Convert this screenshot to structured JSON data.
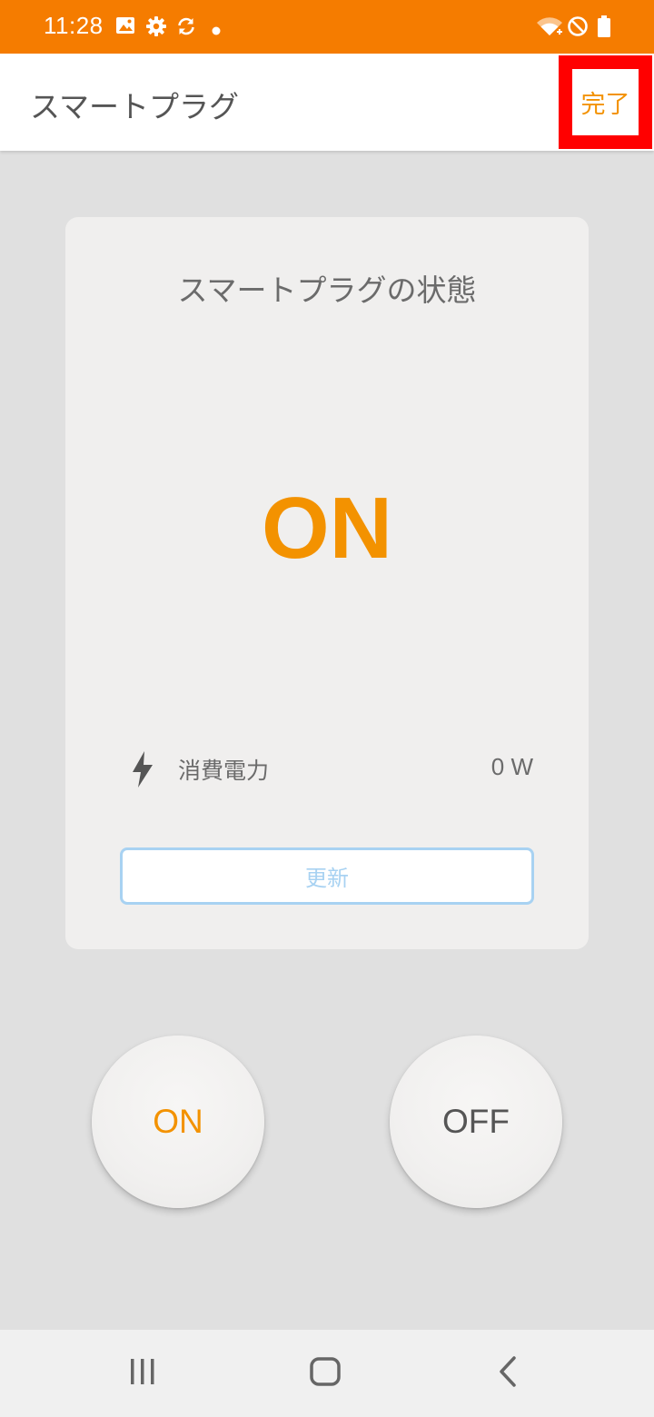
{
  "status_bar": {
    "time": "11:28",
    "background_color": "#f57c00",
    "left_icons": [
      "image-icon",
      "settings-gear-icon",
      "sync-icon",
      "dot-icon"
    ],
    "right_icons": [
      "wifi-icon",
      "blocked-icon",
      "battery-icon"
    ]
  },
  "app_bar": {
    "title": "スマートプラグ",
    "done_label": "完了"
  },
  "status_card": {
    "title": "スマートプラグの状態",
    "state": "ON",
    "power_icon": "lightning-bolt-icon",
    "power_label": "消費電力",
    "power_value": "0 W",
    "refresh_label": "更新"
  },
  "controls": {
    "on_label": "ON",
    "off_label": "OFF"
  },
  "nav_bar": {
    "items": [
      "recent-apps-icon",
      "home-icon",
      "back-icon"
    ]
  },
  "colors": {
    "accent": "#f39200",
    "highlight_box": "#ff0000",
    "refresh_border": "#a8d2f2"
  }
}
